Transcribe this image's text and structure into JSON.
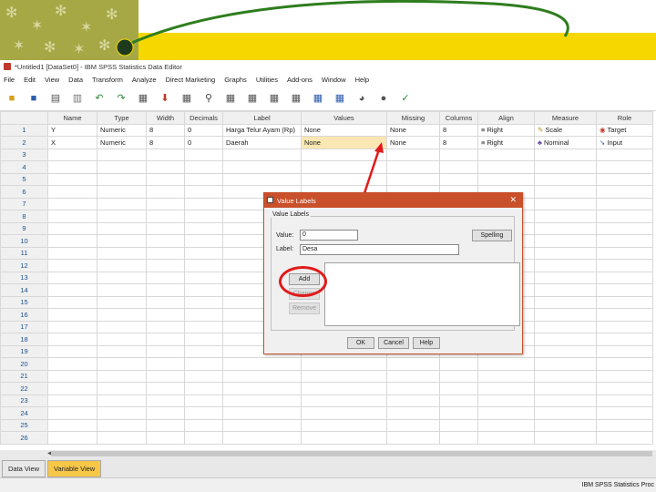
{
  "window": {
    "title": "*Untitled1 [DataSet0] - IBM SPSS Statistics Data Editor"
  },
  "menubar": [
    "File",
    "Edit",
    "View",
    "Data",
    "Transform",
    "Analyze",
    "Direct Marketing",
    "Graphs",
    "Utilities",
    "Add-ons",
    "Window",
    "Help"
  ],
  "grid": {
    "columns": [
      "Name",
      "Type",
      "Width",
      "Decimals",
      "Label",
      "Values",
      "Missing",
      "Columns",
      "Align",
      "Measure",
      "Role"
    ],
    "rows": [
      {
        "num": "1",
        "name": "Y",
        "type": "Numeric",
        "width": "8",
        "decimals": "0",
        "label": "Harga Telur Ayam (Rp)",
        "values": "None",
        "missing": "None",
        "columns": "8",
        "align": "Right",
        "measure": "Scale",
        "role": "Target"
      },
      {
        "num": "2",
        "name": "X",
        "type": "Numeric",
        "width": "8",
        "decimals": "0",
        "label": "Daerah",
        "values": "None",
        "missing": "None",
        "columns": "8",
        "align": "Right",
        "measure": "Nominal",
        "role": "Input"
      }
    ],
    "empty_rows": [
      "3",
      "4",
      "5",
      "6",
      "7",
      "8",
      "9",
      "10",
      "11",
      "12",
      "13",
      "14",
      "15",
      "16",
      "17",
      "18",
      "19",
      "20",
      "21",
      "22",
      "23",
      "24",
      "25",
      "26"
    ]
  },
  "view_tabs": {
    "data": "Data View",
    "variable": "Variable View"
  },
  "status": "IBM SPSS Statistics Proc",
  "dialog": {
    "title": "Value Labels",
    "group": "Value Labels",
    "value_label": "Value:",
    "value": "0",
    "label_label": "Label:",
    "label_value": "Desa",
    "spelling": "Spelling",
    "add": "Add",
    "change": "Change",
    "remove": "Remove",
    "ok": "OK",
    "cancel": "Cancel",
    "help": "Help"
  },
  "colors": {
    "accent": "#f6d800",
    "dialog_title": "#c8502a",
    "annotation": "#e01b1b",
    "arc": "#2e7d1e"
  }
}
